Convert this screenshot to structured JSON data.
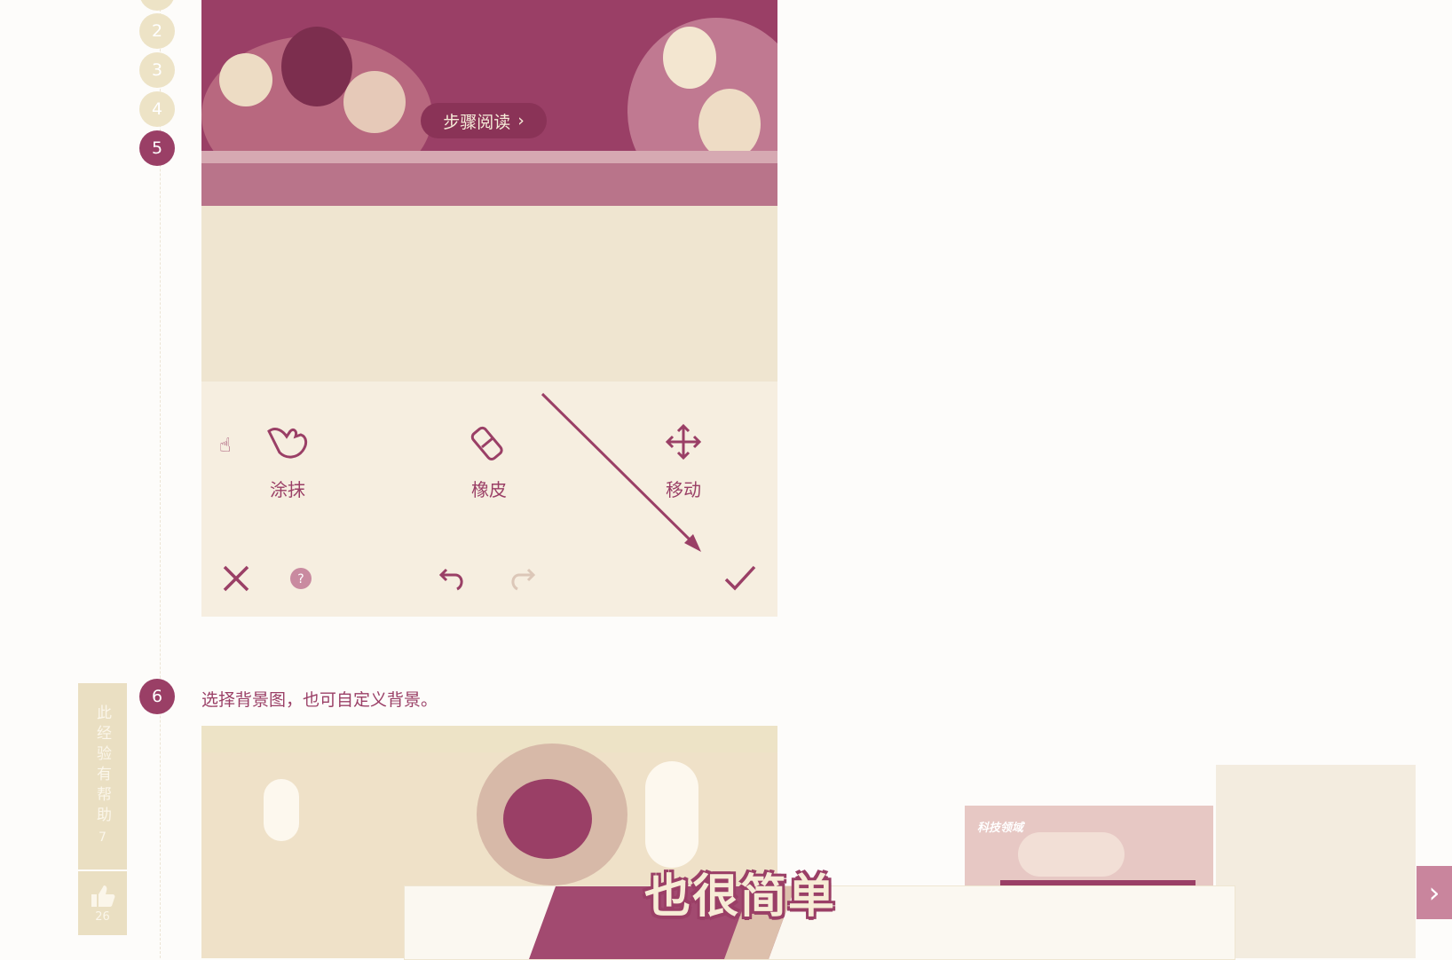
{
  "steps": {
    "items": [
      {
        "number": "2"
      },
      {
        "number": "3"
      },
      {
        "number": "4"
      },
      {
        "number": "5"
      }
    ],
    "step6": {
      "number": "6",
      "text": "选择背景图，也可自定义背景。"
    }
  },
  "screenshot": {
    "reading_pill": "步骤阅读",
    "tools": {
      "smear": "涂抹",
      "eraser": "橡皮",
      "move": "移动"
    }
  },
  "helpful": {
    "label": "此经验有帮助",
    "count": "7",
    "likes": "26"
  },
  "video": {
    "caption": "也很简单",
    "thumb_label": "科技领域"
  },
  "colors": {
    "accent": "#9a3f66",
    "inactive_circle": "#ede3c6",
    "panel_bg": "#f6eee0"
  }
}
